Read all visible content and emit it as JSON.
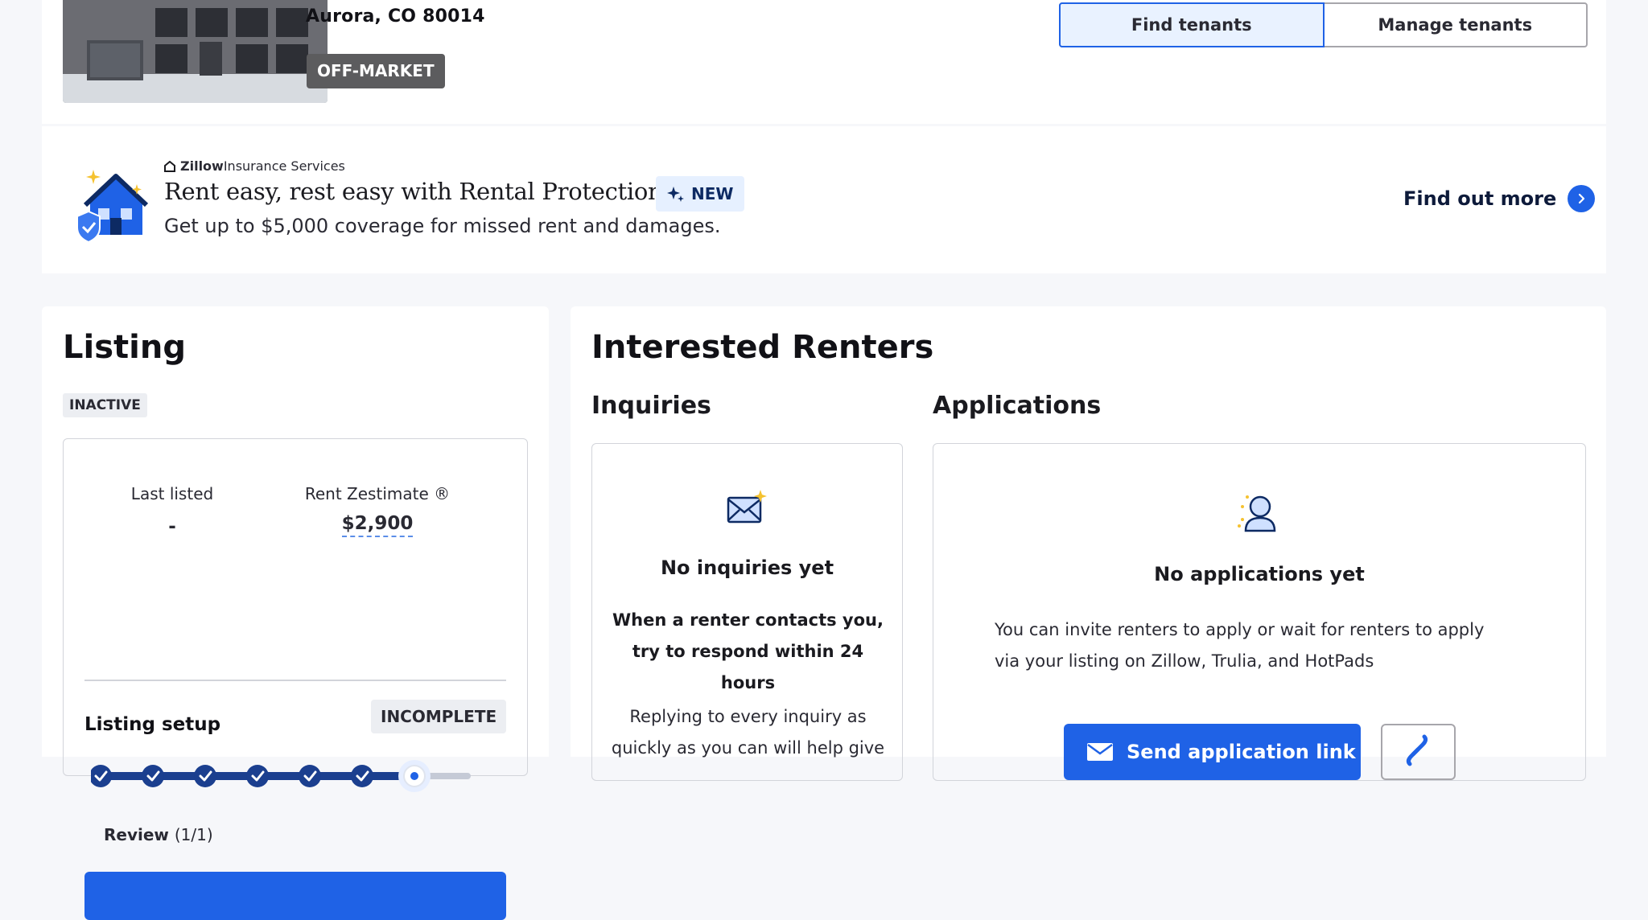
{
  "property": {
    "address": "Aurora, CO 80014",
    "status": "OFF-MARKET",
    "toggle": {
      "find_label": "Find tenants",
      "manage_label": "Manage tenants",
      "selected": "Find tenants"
    }
  },
  "insurance": {
    "brand_bold": "Zillow",
    "brand_rest": "Insurance Services",
    "headline": "Rent easy, rest easy with Rental Protection",
    "badge": "NEW",
    "subtitle": "Get up to $5,000 coverage for missed rent and damages.",
    "link_label": "Find out more"
  },
  "listing": {
    "title": "Listing",
    "status": "INACTIVE",
    "last_listed_label": "Last listed",
    "last_listed_value": "-",
    "rent_label": "Rent Zestimate ®",
    "rent_value": "$2,900",
    "setup_label": "Listing setup",
    "setup_status": "INCOMPLETE",
    "steps_completed": 6,
    "steps_total": 7,
    "current_step_label": "Review",
    "current_step_count": "(1/1)"
  },
  "renters": {
    "title": "Interested Renters",
    "inquiries": {
      "title": "Inquiries",
      "empty_title": "No inquiries yet",
      "hint": "When a renter contacts you, try to respond within 24 hours",
      "body": "Replying to every inquiry as quickly as you can will help give"
    },
    "applications": {
      "title": "Applications",
      "empty_title": "No applications yet",
      "body": "You can invite renters to apply or wait for renters to apply via your listing on Zillow, Trulia, and HotPads",
      "send_button": "Send application link"
    }
  },
  "colors": {
    "accent": "#1f62e6",
    "progress": "#1b3f8f",
    "chip": "#5c5c5e"
  }
}
